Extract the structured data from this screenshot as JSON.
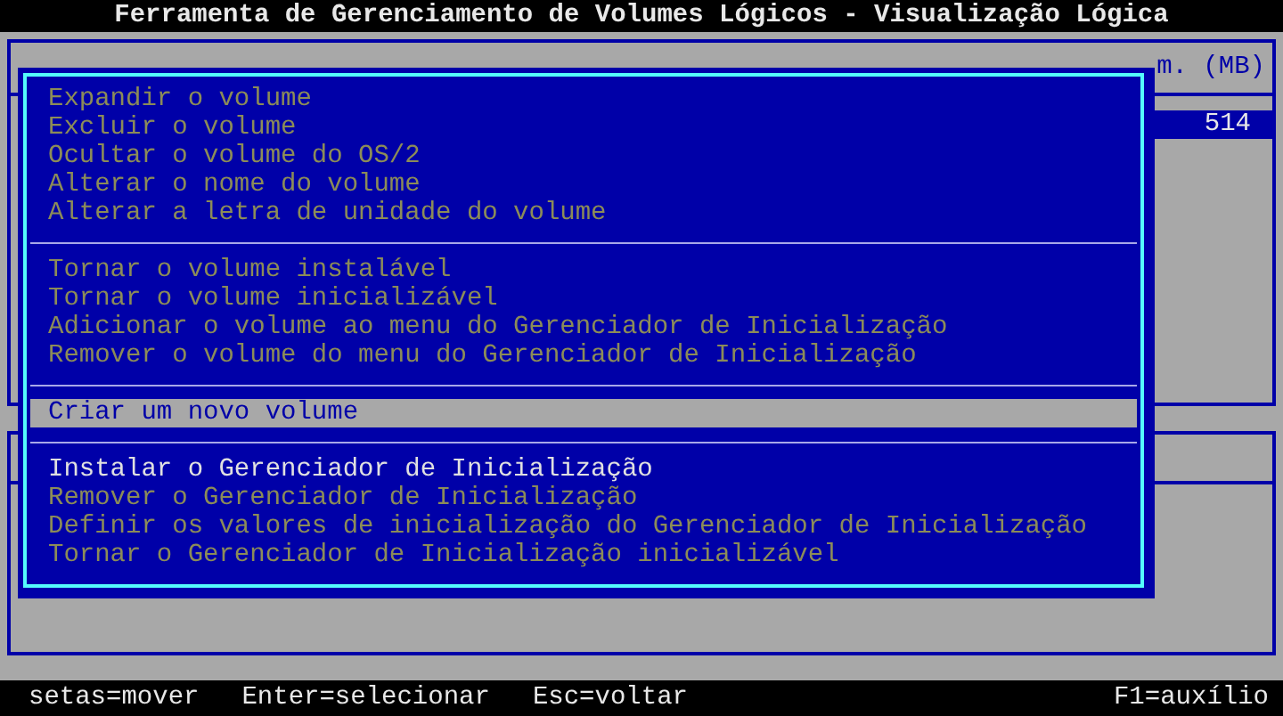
{
  "window": {
    "title": "Ferramenta de Gerenciamento de Volumes Lógicos - Visualização Lógica"
  },
  "background": {
    "column_header": "m. (MB)",
    "rows": [
      {
        "value": "514",
        "selected": true
      }
    ]
  },
  "menu": {
    "groups": [
      {
        "items": [
          {
            "label": "Expandir o volume",
            "disabled": true,
            "selected": false
          },
          {
            "label": "Excluir o volume",
            "disabled": true,
            "selected": false
          },
          {
            "label": "Ocultar o volume do OS/2",
            "disabled": true,
            "selected": false
          },
          {
            "label": "Alterar o nome do volume",
            "disabled": true,
            "selected": false
          },
          {
            "label": "Alterar a letra de unidade do volume",
            "disabled": true,
            "selected": false
          }
        ]
      },
      {
        "items": [
          {
            "label": "Tornar o volume instalável",
            "disabled": true,
            "selected": false
          },
          {
            "label": "Tornar o volume inicializável",
            "disabled": true,
            "selected": false
          },
          {
            "label": "Adicionar o volume ao menu do Gerenciador de Inicialização",
            "disabled": true,
            "selected": false
          },
          {
            "label": "Remover o volume do menu do Gerenciador de Inicialização",
            "disabled": true,
            "selected": false
          }
        ]
      },
      {
        "items": [
          {
            "label": "Criar um novo volume",
            "disabled": false,
            "selected": true
          }
        ]
      },
      {
        "items": [
          {
            "label": "Instalar o Gerenciador de Inicialização",
            "disabled": false,
            "selected": false
          },
          {
            "label": "Remover o Gerenciador de Inicialização",
            "disabled": true,
            "selected": false
          },
          {
            "label": "Definir os valores de inicialização do Gerenciador de Inicialização",
            "disabled": true,
            "selected": false
          },
          {
            "label": "Tornar o Gerenciador de Inicialização inicializável",
            "disabled": true,
            "selected": false
          }
        ]
      }
    ]
  },
  "status_bar": {
    "hints": [
      "setas=mover",
      "Enter=selecionar",
      "Esc=voltar"
    ],
    "help": "F1=auxílio"
  }
}
